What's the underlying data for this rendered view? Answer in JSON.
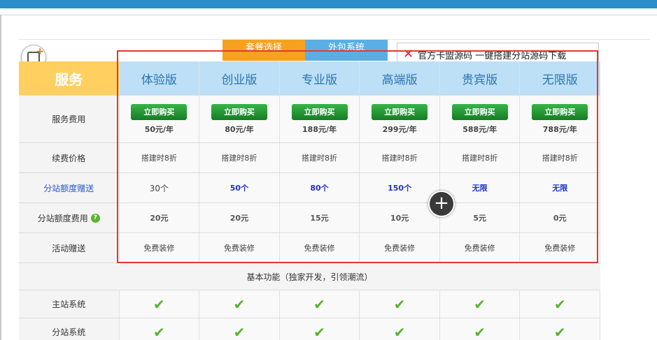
{
  "tabs": [
    {
      "label": "套餐选择"
    },
    {
      "label": "外包系统"
    }
  ],
  "notice": {
    "text": "官方卡盟源码 一键搭建分站源码下载"
  },
  "header": {
    "service_label": "服务",
    "plans": [
      "体验版",
      "创业版",
      "专业版",
      "高端版",
      "贵宾版",
      "无限版"
    ]
  },
  "rows": {
    "fee": {
      "label": "服务费用",
      "buy_label": "立即购买",
      "prices": [
        "50元/年",
        "80元/年",
        "188元/年",
        "299元/年",
        "588元/年",
        "788元/年"
      ]
    },
    "renewal": {
      "label": "续费价格",
      "values": [
        "搭建时8折",
        "搭建时8折",
        "搭建时8折",
        "搭建时8折",
        "搭建时8折",
        "搭建时8折"
      ]
    },
    "quota_gift": {
      "label": "分站额度赠送",
      "values": [
        "30个",
        "50个",
        "80个",
        "150个",
        "无限",
        "无限"
      ]
    },
    "quota_fee": {
      "label": "分站额度费用",
      "values": [
        "20元",
        "20元",
        "15元",
        "10元",
        "5元",
        "0元"
      ]
    },
    "activity": {
      "label": "活动赠送",
      "values": [
        "免费装修",
        "免费装修",
        "免费装修",
        "免费装修",
        "免费装修",
        "免费装修"
      ]
    },
    "basic": {
      "label": "基本功能（独家开发，引领潮流）"
    },
    "main_system": {
      "label": "主站系统"
    },
    "sub_system": {
      "label": "分站系统"
    }
  },
  "colors": {
    "accent_blue": "#2a8fc8",
    "tab_orange": "#f6a21e",
    "tab_blue": "#5aaee4",
    "service_header": "#ffcf60",
    "plan_header": "#bee0f6",
    "buy_green": "#2a9c37",
    "check_green": "#58b231",
    "highlight_red": "#e2392e"
  },
  "icons": {
    "check": "check-icon",
    "close": "close-icon",
    "help": "help-icon",
    "zoom": "plus-icon",
    "add": "add-badge-icon"
  }
}
